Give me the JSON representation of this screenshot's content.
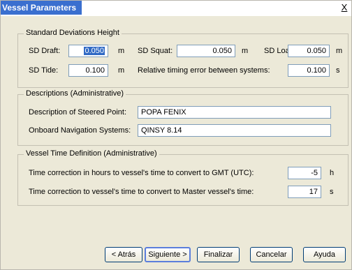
{
  "window": {
    "title": "Vessel Parameters",
    "close_label": "X"
  },
  "sd_height": {
    "legend": "Standard Deviations Height",
    "sd_draft_label": "SD Draft:",
    "sd_draft_value": "0.050",
    "sd_draft_unit": "m",
    "sd_squat_label": "SD Squat:",
    "sd_squat_value": "0.050",
    "sd_squat_unit": "m",
    "sd_load_label": "SD Load:",
    "sd_load_value": "0.050",
    "sd_load_unit": "m",
    "sd_tide_label": "SD Tide:",
    "sd_tide_value": "0.100",
    "sd_tide_unit": "m",
    "timing_label": "Relative timing error between systems:",
    "timing_value": "0.100",
    "timing_unit": "s"
  },
  "descriptions": {
    "legend": "Descriptions (Administrative)",
    "steered_label": "Description of Steered Point:",
    "steered_value": "POPA FENIX",
    "nav_label": "Onboard Navigation Systems:",
    "nav_value": "QINSY 8.14"
  },
  "time_def": {
    "legend": "Vessel Time Definition (Administrative)",
    "gmt_label": "Time correction in hours to vessel's time to convert to GMT (UTC):",
    "gmt_value": "-5",
    "gmt_unit": "h",
    "master_label": "Time correction to vessel's time to convert to Master vessel's time:",
    "master_value": "17",
    "master_unit": "s"
  },
  "buttons": {
    "back": "< Atrás",
    "next": "Siguiente >",
    "finish": "Finalizar",
    "cancel": "Cancelar",
    "help": "Ayuda"
  }
}
